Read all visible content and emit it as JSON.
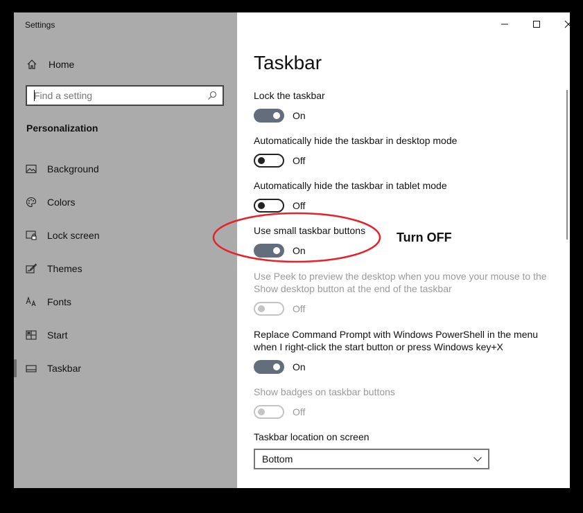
{
  "window": {
    "title": "Settings"
  },
  "sidebar": {
    "home_label": "Home",
    "search_placeholder": "Find a setting",
    "section_label": "Personalization",
    "items": [
      {
        "label": "Background",
        "icon": "image-icon"
      },
      {
        "label": "Colors",
        "icon": "palette-icon"
      },
      {
        "label": "Lock screen",
        "icon": "lock-screen-icon"
      },
      {
        "label": "Themes",
        "icon": "brush-icon"
      },
      {
        "label": "Fonts",
        "icon": "font-icon"
      },
      {
        "label": "Start",
        "icon": "start-icon"
      },
      {
        "label": "Taskbar",
        "icon": "taskbar-icon",
        "selected": true
      }
    ]
  },
  "main": {
    "title": "Taskbar",
    "settings": [
      {
        "label": "Lock the taskbar",
        "state": "On",
        "enabled": true
      },
      {
        "label": "Automatically hide the taskbar in desktop mode",
        "state": "Off",
        "enabled": true
      },
      {
        "label": "Automatically hide the taskbar in tablet mode",
        "state": "Off",
        "enabled": true
      },
      {
        "label": "Use small taskbar buttons",
        "state": "On",
        "enabled": true
      },
      {
        "label": "Use Peek to preview the desktop when you move your mouse to the Show desktop button at the end of the taskbar",
        "state": "Off",
        "enabled": false
      },
      {
        "label": "Replace Command Prompt with Windows PowerShell in the menu when I right-click the start button or press Windows key+X",
        "state": "On",
        "enabled": true
      },
      {
        "label": "Show badges on taskbar buttons",
        "state": "Off",
        "enabled": false
      }
    ],
    "location_label": "Taskbar location on screen",
    "location_value": "Bottom"
  },
  "annotation": {
    "text": "Turn OFF",
    "color": "#e8202a"
  },
  "colors": {
    "sidebar_bg": "#ababab",
    "toggle_on": "#636d7c"
  }
}
